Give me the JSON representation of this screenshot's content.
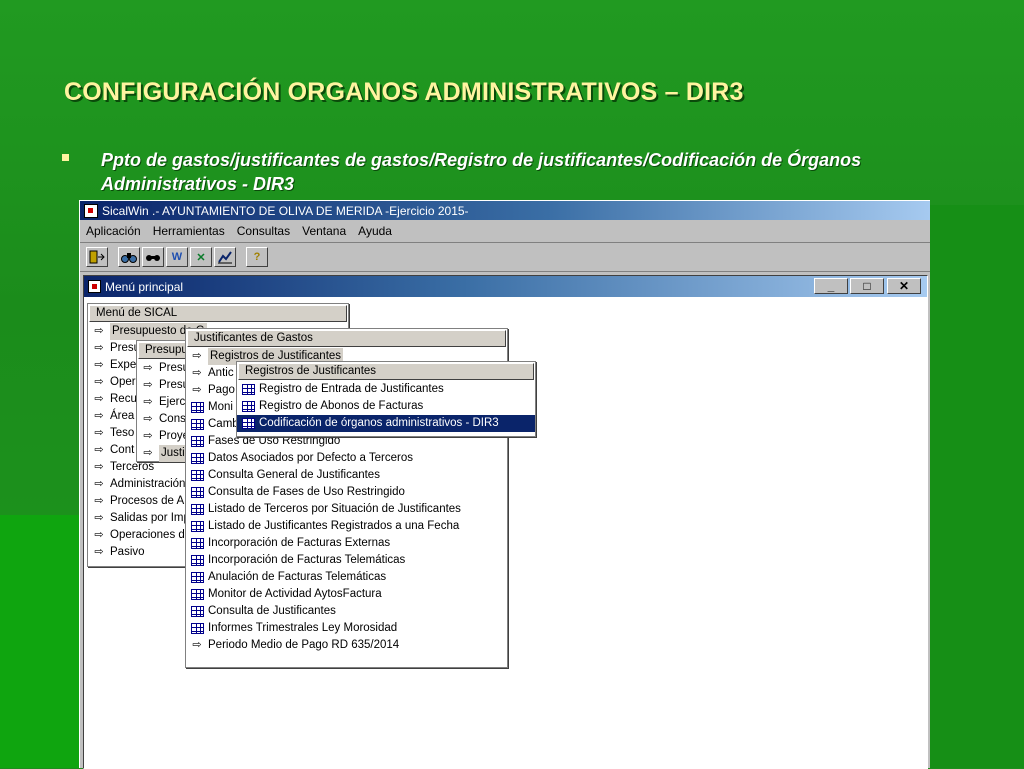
{
  "slide": {
    "title": "CONFIGURACIÓN ORGANOS ADMINISTRATIVOS – DIR3",
    "bullet_line1": "Ppto de gastos/justificantes de gastos/Registro de justificantes/Codificación de Órganos",
    "bullet_line2": "Administrativos - DIR3"
  },
  "window": {
    "title": "SicalWin  .- AYUNTAMIENTO DE OLIVA DE MERIDA -Ejercicio 2015-",
    "menu": [
      "Aplicación",
      "Herramientas",
      "Consultas",
      "Ventana",
      "Ayuda"
    ],
    "toolbar_icons": [
      "exit-icon",
      "binoculars-icon",
      "search-icon",
      "word-icon",
      "excel-icon",
      "chart-icon",
      "help-icon"
    ]
  },
  "mdi": {
    "title": "Menú principal",
    "controls": [
      "_",
      "□",
      "✕"
    ]
  },
  "menu_sical": {
    "header": "Menú de SICAL",
    "items": [
      "Presupuesto de G",
      "Presu",
      "Expe",
      "Oper",
      "Recu",
      "Área",
      "Teso",
      "Cont",
      "Terceros",
      "Administración",
      "Procesos de A",
      "Salidas por Imp",
      "Operaciones d",
      "Pasivo"
    ]
  },
  "menu_presupuesto": {
    "header": "Presupu",
    "items": [
      "Presu",
      "Presu",
      "Ejerc",
      "Cons",
      "Proye",
      "Justi"
    ]
  },
  "menu_justificantes": {
    "header": "Justificantes de Gastos",
    "items": [
      {
        "label": "Registros de Justificantes",
        "icon": "arrow"
      },
      {
        "label": "Antic",
        "icon": "arrow"
      },
      {
        "label": "Pago",
        "icon": "arrow"
      },
      {
        "label": "Moni",
        "icon": "grid"
      },
      {
        "label": "Camb",
        "icon": "grid"
      },
      {
        "label": "Fases de Uso Restringido",
        "icon": "grid"
      },
      {
        "label": "Datos Asociados por Defecto a Terceros",
        "icon": "grid"
      },
      {
        "label": "Consulta General de Justificantes",
        "icon": "grid"
      },
      {
        "label": "Consulta de Fases de Uso Restringido",
        "icon": "grid"
      },
      {
        "label": "Listado de Terceros por Situación de Justificantes",
        "icon": "grid"
      },
      {
        "label": "Listado de Justificantes Registrados a una Fecha",
        "icon": "grid"
      },
      {
        "label": "Incorporación de Facturas Externas",
        "icon": "grid"
      },
      {
        "label": "Incorporación de Facturas Telemáticas",
        "icon": "grid"
      },
      {
        "label": "Anulación de Facturas Telemáticas",
        "icon": "grid"
      },
      {
        "label": "Monitor de Actividad AytosFactura",
        "icon": "grid"
      },
      {
        "label": "Consulta de Justificantes",
        "icon": "grid"
      },
      {
        "label": "Informes Trimestrales Ley Morosidad",
        "icon": "grid"
      },
      {
        "label": "Periodo Medio de Pago RD 635/2014",
        "icon": "arrow"
      }
    ]
  },
  "menu_registros": {
    "header": "Registros de Justificantes",
    "items": [
      "Registro de Entrada de Justificantes",
      "Registro de Abonos de Facturas",
      "Codificación de órganos administrativos - DIR3"
    ]
  }
}
